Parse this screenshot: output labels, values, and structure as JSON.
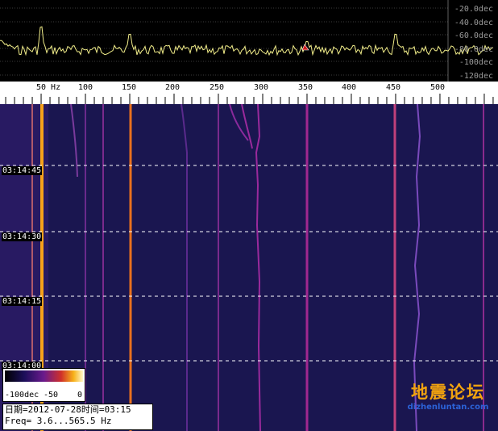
{
  "spectrum": {
    "db_labels": [
      "-20.0dec",
      "-40.0dec",
      "-60.0dec",
      "-80.0dec",
      "-100dec",
      "-120dec"
    ],
    "db_range": [
      -130,
      -10
    ],
    "trace_color": "#f2ee8a",
    "grid_color": "#7a7a7a",
    "freq_range_hz": [
      3.6,
      565.5
    ],
    "peaks_hz": [
      50,
      150,
      350,
      450
    ]
  },
  "scale": {
    "freq_labels": [
      "50 Hz",
      "100",
      "150",
      "200",
      "250",
      "300",
      "350",
      "400",
      "450",
      "500"
    ],
    "freq_values": [
      50,
      100,
      150,
      200,
      250,
      300,
      350,
      400,
      450,
      500
    ]
  },
  "waterfall": {
    "time_labels": [
      "03:14:45",
      "03:14:30",
      "03:14:15",
      "03:14:00"
    ],
    "background_color": "#1a1650",
    "hot_line_color": "#f7a21a",
    "line_color": "#b02a8c"
  },
  "legend": {
    "labels": [
      "-100dec",
      "-50",
      "0"
    ]
  },
  "info": {
    "date_line": "日期=2012-07-28时间=03:15",
    "freq_line": "Freq= 3.6...565.5 Hz"
  },
  "watermark": {
    "title": "地震论坛",
    "url": "dizhenluntan.com",
    "title_color": "#f2a40f",
    "url_color": "#2c63d8"
  }
}
